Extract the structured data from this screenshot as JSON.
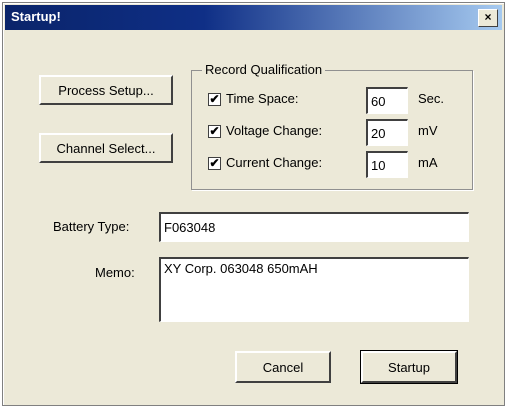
{
  "window": {
    "title": "Startup!",
    "close_glyph": "×"
  },
  "buttons": {
    "process_setup": "Process Setup...",
    "channel_select": "Channel Select...",
    "cancel": "Cancel",
    "startup": "Startup"
  },
  "record_qualification": {
    "label": "Record Qualification",
    "rows": [
      {
        "label": "Time Space:",
        "checked": true,
        "value": "60",
        "unit": "Sec."
      },
      {
        "label": "Voltage Change:",
        "checked": true,
        "value": "20",
        "unit": "mV"
      },
      {
        "label": "Current Change:",
        "checked": true,
        "value": "10",
        "unit": "mA"
      }
    ],
    "check_glyph": "✔"
  },
  "battery_type": {
    "label": "Battery Type:",
    "value": "F063048"
  },
  "memo": {
    "label": "Memo:",
    "value": "XY Corp. 063048 650mAH"
  },
  "colors": {
    "dialog_bg": "#ece9d8",
    "titlebar_start": "#0a246a",
    "titlebar_end": "#a6caf0"
  }
}
